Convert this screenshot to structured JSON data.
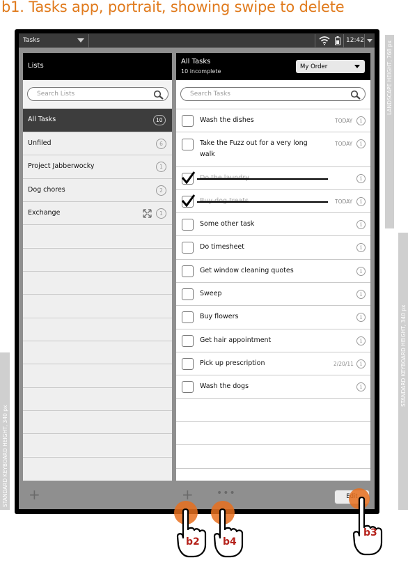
{
  "title": "b1. Tasks app, portrait, showing swipe to delete",
  "annotations": {
    "landscape_height": "LANDSCAPE HEIGHT, 768 px",
    "keyboard_height_right": "STANDARD KEYBOARD HEIGHT, 340 px",
    "keyboard_height_left": "STANDARD KEYBOARD HEIGHT, 340 px"
  },
  "statusbar": {
    "app_name": "Tasks",
    "time": "12:42"
  },
  "lists_panel": {
    "title": "Lists",
    "search_placeholder": "Search Lists",
    "items": [
      {
        "label": "All Tasks",
        "count": "10",
        "selected": true
      },
      {
        "label": "Unfiled",
        "count": "6"
      },
      {
        "label": "Project Jabberwocky",
        "count": "1"
      },
      {
        "label": "Dog chores",
        "count": "2"
      },
      {
        "label": "Exchange",
        "count": "1",
        "sync_icon": "sync-icon"
      }
    ]
  },
  "tasks_panel": {
    "title": "All Tasks",
    "subtitle": "10 incomplete",
    "order_label": "My Order",
    "search_placeholder": "Search Tasks",
    "tasks": [
      {
        "label": "Wash the dishes",
        "date": "TODAY"
      },
      {
        "label_line1": "Take the Fuzz out for a very long",
        "label_line2": "walk",
        "date": "TODAY"
      },
      {
        "label": "Do the laundry",
        "done": true,
        "date": ""
      },
      {
        "label": "Buy dog treats",
        "done": true,
        "date": "TODAY"
      },
      {
        "label": "Some other task",
        "date": ""
      },
      {
        "label": "Do timesheet",
        "date": ""
      },
      {
        "label": "Get window cleaning quotes",
        "date": ""
      },
      {
        "label": "Sweep",
        "date": ""
      },
      {
        "label": "Buy flowers",
        "date": ""
      },
      {
        "label": "Get hair appointment",
        "date": ""
      },
      {
        "label": "Pick up prescription",
        "date": "2/20/11"
      },
      {
        "label": "Wash the dogs",
        "date": ""
      }
    ],
    "info_glyph": "i"
  },
  "bottom_bar": {
    "add_glyph": "+",
    "more_glyph": "•••",
    "edit_label": "Edit"
  },
  "callouts": {
    "b2": "b2",
    "b4": "b4",
    "b3": "b3"
  },
  "colors": {
    "title": "#e07a1c",
    "touch": "#e7701e",
    "callout": "#b5221b"
  }
}
